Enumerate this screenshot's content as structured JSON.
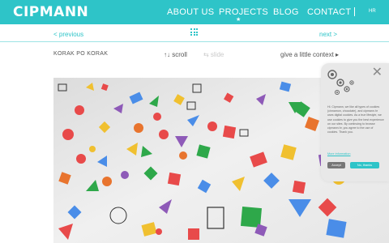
{
  "header": {
    "logo": "CIPMANN",
    "nav": {
      "about": "ABOUT US",
      "projects": "PROJECTS",
      "blog": "BLOG",
      "contact": "CONTACT"
    },
    "active_marker": "★",
    "language": "HR"
  },
  "subnav": {
    "previous": "< previous",
    "next": "next >"
  },
  "project": {
    "title": "KORAK PO KORAK",
    "scroll": "↑↓ scroll",
    "slide": "⇆ slide",
    "context": "give a little context ▸"
  },
  "cookie": {
    "text": "Hi. Cipmann, we like all types of cookies (cinnamon, chocolate), and cipmann.hr uses digital cookies. As a true lifestyle, we use cookies to give you the best experience on our sites. By continuing to browse cipmann.hr, you agree to the use of cookies. Thank you.",
    "more_info": "More information",
    "accept": "Accept",
    "no_thanks": "No, thanks"
  },
  "colors": {
    "accent": "#2ec4c8"
  }
}
